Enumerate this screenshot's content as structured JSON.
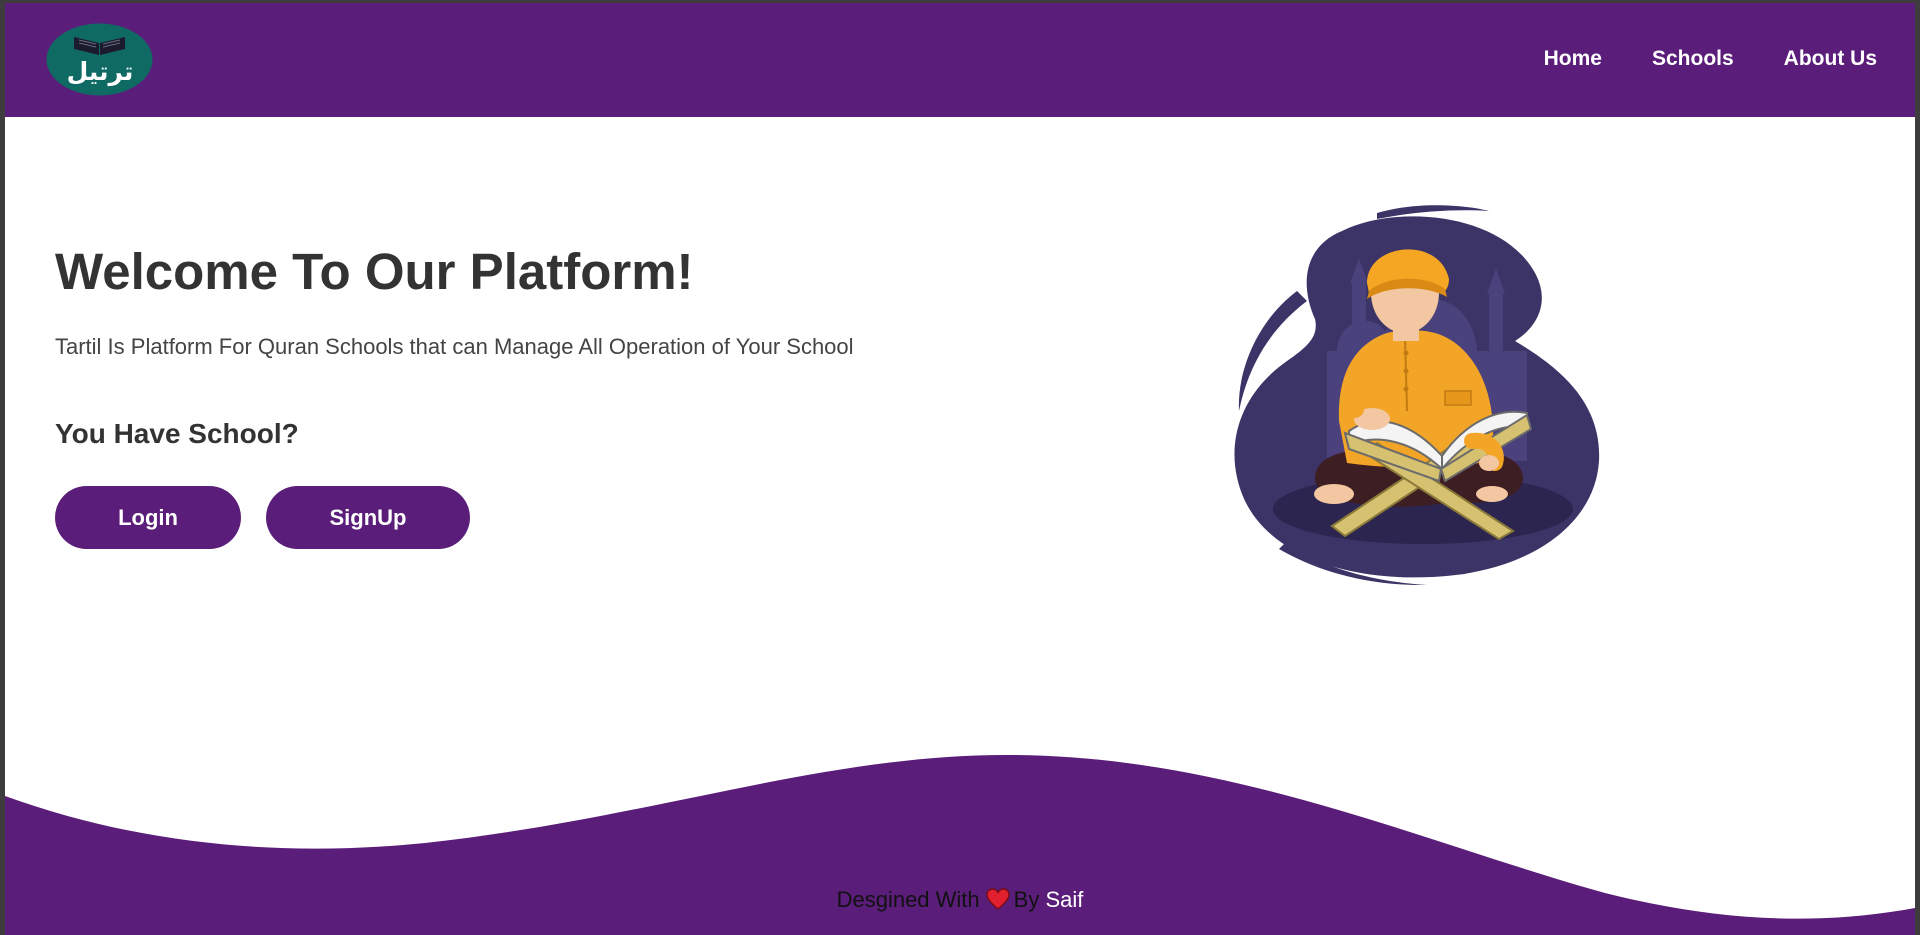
{
  "brand": {
    "logo_text": "ترتيل",
    "logo_icon": "open-book-icon",
    "primary_color": "#5b1d7a",
    "logo_bg_color": "#0e6a63"
  },
  "nav": {
    "items": [
      {
        "label": "Home"
      },
      {
        "label": "Schools"
      },
      {
        "label": "About Us"
      }
    ]
  },
  "hero": {
    "title": "Welcome To Our Platform!",
    "description": "Tartil Is Platform For Quran Schools that can Manage All Operation of Your School",
    "question": "You Have School?",
    "login_label": "Login",
    "signup_label": "SignUp",
    "illustration": "boy-reading-quran-illustration"
  },
  "footer": {
    "prefix": "Desgined With",
    "icon": "heart-icon",
    "by": "By",
    "author": "Saif"
  }
}
